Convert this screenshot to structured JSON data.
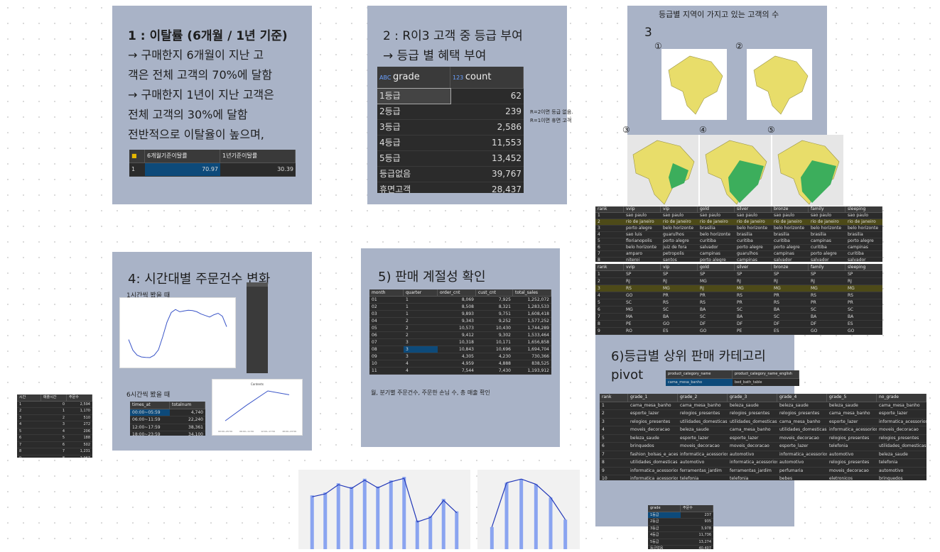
{
  "card1": {
    "title": "1 : 이탈률 (6개월 / 1년 기준)",
    "lines": [
      "→ 구매한지 6개월이 지난 고",
      "객은 전체 고객의 70%에 달함",
      "→ 구매한지 1년이 지난 고객은",
      "전체 고객의 30%에 달함",
      "전반적으로 이탈율이 높으며,"
    ],
    "grid": {
      "headers": [
        "6개월기준이탈률",
        "1년기준이탈률"
      ],
      "row_num": "1",
      "values": [
        "70.97",
        "30.39"
      ]
    }
  },
  "card2": {
    "title": "2 : R이3 고객 중 등급 부여",
    "subtitle": "→ 등급 별 혜택 부여",
    "grid": {
      "col1": "grade",
      "col2": "count",
      "rows": [
        [
          "1등급",
          "62"
        ],
        [
          "2등급",
          "239"
        ],
        [
          "3등급",
          "2,586"
        ],
        [
          "4등급",
          "11,553"
        ],
        [
          "5등급",
          "13,452"
        ],
        [
          "등급없음",
          "39,767"
        ],
        [
          "휴면고객",
          "28,437"
        ]
      ]
    },
    "note1": "R=2이면 등급 없음.",
    "note2": "R=1이면 휴면 고객"
  },
  "card3": {
    "title": "등급별 지역이 가지고 있는 고객의 수",
    "number": "3",
    "circles": [
      "①",
      "②",
      "③",
      "④",
      "⑤"
    ]
  },
  "city_grid": {
    "headers": [
      "rank",
      "vvip",
      "vip",
      "gold",
      "silver",
      "bronze",
      "family",
      "sleeping"
    ],
    "rows": [
      [
        "1",
        "sao paulo",
        "sao paulo",
        "sao paulo",
        "sao paulo",
        "sao paulo",
        "sao paulo",
        "sao paulo"
      ],
      [
        "2",
        "rio de janeiro",
        "rio de janeiro",
        "rio de janeiro",
        "rio de janeiro",
        "rio de janeiro",
        "rio de janeiro",
        "rio de janeiro"
      ],
      [
        "3",
        "porto alegre",
        "belo horizonte",
        "brasilia",
        "belo horizonte",
        "belo horizonte",
        "belo horizonte",
        "belo horizonte"
      ],
      [
        "4",
        "sao luis",
        "guarulhos",
        "belo horizonte",
        "brasilia",
        "brasilia",
        "brasilia",
        "brasilia"
      ],
      [
        "5",
        "florianopolis",
        "porto alegre",
        "curitiba",
        "curitiba",
        "curitiba",
        "campinas",
        "porto alegre"
      ],
      [
        "6",
        "belo horizonte",
        "juiz de fora",
        "salvador",
        "porto alegre",
        "porto alegre",
        "curitiba",
        "campinas"
      ],
      [
        "7",
        "amparo",
        "petropolis",
        "campinas",
        "guarulhos",
        "campinas",
        "porto alegre",
        "curitiba"
      ],
      [
        "8",
        "niteroi",
        "santos",
        "porto alegre",
        "campinas",
        "salvador",
        "salvador",
        "salvador"
      ]
    ]
  },
  "state_grid": {
    "headers": [
      "rank",
      "vvip",
      "vip",
      "gold",
      "silver",
      "bronze",
      "family",
      "sleeping"
    ],
    "rows": [
      [
        "1",
        "SP",
        "SP",
        "SP",
        "SP",
        "SP",
        "SP",
        "SP"
      ],
      [
        "2",
        "RJ",
        "RJ",
        "MG",
        "RJ",
        "RJ",
        "RJ",
        "RJ"
      ],
      [
        "3",
        "RS",
        "MG",
        "RJ",
        "MG",
        "MG",
        "MG",
        "MG"
      ],
      [
        "4",
        "GO",
        "PR",
        "PR",
        "RS",
        "PR",
        "RS",
        "RS"
      ],
      [
        "5",
        "SC",
        "RS",
        "RS",
        "PR",
        "RS",
        "PR",
        "PR"
      ],
      [
        "6",
        "MG",
        "SC",
        "BA",
        "SC",
        "BA",
        "SC",
        "SC"
      ],
      [
        "7",
        "MA",
        "BA",
        "SC",
        "BA",
        "SC",
        "BA",
        "BA"
      ],
      [
        "8",
        "PE",
        "GO",
        "DF",
        "DF",
        "DF",
        "DF",
        "ES"
      ],
      [
        "9",
        "RO",
        "ES",
        "GO",
        "PE",
        "ES",
        "GO",
        "GO"
      ],
      [
        "10",
        "PB",
        "CE",
        "PE",
        "ES",
        "GO",
        "ES",
        "DF"
      ]
    ]
  },
  "card4": {
    "title": "4: 시간대별 주문건수 변화",
    "sub1": "1시간씩 봤을 때",
    "sub2": "6시간씩 봤을 때",
    "grid6": {
      "headers": [
        "times_at",
        "totalnum"
      ],
      "rows": [
        [
          "00:00~05:59",
          "4,740"
        ],
        [
          "06:00~11:59",
          "22,240"
        ],
        [
          "12:00~17:59",
          "38,361"
        ],
        [
          "18:00~23:59",
          "34,100"
        ]
      ]
    }
  },
  "hour_grid": {
    "headers": [
      "시간",
      "매출시간",
      "주문수"
    ],
    "rows": [
      [
        "1",
        "0",
        "2,594"
      ],
      [
        "2",
        "1",
        "1,170"
      ],
      [
        "3",
        "2",
        "510"
      ],
      [
        "4",
        "3",
        "272"
      ],
      [
        "5",
        "4",
        "206"
      ],
      [
        "6",
        "5",
        "188"
      ],
      [
        "7",
        "6",
        "502"
      ],
      [
        "8",
        "7",
        "1,231"
      ],
      [
        "9",
        "8",
        "2,967"
      ]
    ]
  },
  "card5": {
    "title": "5) 판매 계절성 확인",
    "caption": "월, 분기별 주문건수, 주문한 손님 수, 총 매출 확인",
    "grid": {
      "headers": [
        "month",
        "quarter",
        "order_cnt",
        "cust_cnt",
        "total_sales"
      ],
      "rows": [
        [
          "01",
          "1",
          "8,069",
          "7,925",
          "1,252,072"
        ],
        [
          "02",
          "1",
          "8,508",
          "8,321",
          "1,283,533"
        ],
        [
          "03",
          "1",
          "9,893",
          "9,751",
          "1,608,418"
        ],
        [
          "04",
          "2",
          "9,343",
          "9,252",
          "1,577,252"
        ],
        [
          "05",
          "2",
          "10,573",
          "10,430",
          "1,744,289"
        ],
        [
          "06",
          "2",
          "9,412",
          "9,302",
          "1,533,464"
        ],
        [
          "07",
          "3",
          "10,318",
          "10,171",
          "1,656,858"
        ],
        [
          "08",
          "3",
          "10,843",
          "10,696",
          "1,694,704"
        ],
        [
          "09",
          "3",
          "4,305",
          "4,230",
          "730,366"
        ],
        [
          "10",
          "4",
          "4,959",
          "4,888",
          "838,525"
        ],
        [
          "11",
          "4",
          "7,544",
          "7,430",
          "1,193,912"
        ],
        [
          "12",
          "4",
          "5,674",
          "5,604",
          "877,610"
        ]
      ]
    }
  },
  "card6": {
    "title": "6)등급별 상위 판매 카테고리",
    "subtitle": "pivot",
    "mini": {
      "headers": [
        "product_category_name",
        "product_category_name_english"
      ],
      "row": [
        "cama_mesa_banho",
        "bed_bath_table"
      ]
    },
    "grid": {
      "headers": [
        "rank",
        "grade_1",
        "grade_2",
        "grade_3",
        "grade_4",
        "grade_5",
        "no_grade"
      ],
      "rows": [
        [
          "1",
          "cama_mesa_banho",
          "cama_mesa_banho",
          "beleza_saude",
          "beleza_saude",
          "beleza_saude",
          "cama_mesa_banho"
        ],
        [
          "2",
          "esporte_lazer",
          "relogios_presentes",
          "relogios_presentes",
          "relogios_presentes",
          "cama_mesa_banho",
          "esporte_lazer"
        ],
        [
          "3",
          "relogios_presentes",
          "utilidades_domesticas",
          "utilidades_domesticas",
          "cama_mesa_banho",
          "esporte_lazer",
          "informatica_acessorios"
        ],
        [
          "4",
          "moveis_decoracao",
          "beleza_saude",
          "cama_mesa_banho",
          "utilidades_domesticas",
          "informatica_acessorios",
          "moveis_decoracao"
        ],
        [
          "5",
          "beleza_saude",
          "esporte_lazer",
          "esporte_lazer",
          "moveis_decoracao",
          "relogios_presentes",
          "relogios_presentes"
        ],
        [
          "6",
          "brinquedos",
          "moveis_decoracao",
          "moveis_decoracao",
          "esporte_lazer",
          "telefonia",
          "utilidades_domesticas"
        ],
        [
          "7",
          "fashion_bolsas_e_acessorios",
          "informatica_acessorios",
          "automotivo",
          "informatica_acessorios",
          "automotivo",
          "beleza_saude"
        ],
        [
          "8",
          "utilidades_domesticas",
          "automotivo",
          "informatica_acessorios",
          "automotivo",
          "relogios_presentes",
          "telefonia"
        ],
        [
          "9",
          "informatica_acessorios",
          "ferramentas_jardim",
          "ferramentas_jardim",
          "perfumaria",
          "moveis_decoracao",
          "automotivo"
        ],
        [
          "10",
          "informatica_acessorios",
          "telefonia",
          "telefonia",
          "bebes",
          "eletronicos",
          "brinquedos"
        ]
      ]
    }
  },
  "grade_mini": {
    "headers": [
      "grade",
      "주문수"
    ],
    "rows": [
      [
        "1등급",
        "237"
      ],
      [
        "2등급",
        "935"
      ],
      [
        "3등급",
        "3,978"
      ],
      [
        "4등급",
        "11,736"
      ],
      [
        "5등급",
        "13,274"
      ],
      [
        "등급없음",
        "40,407"
      ]
    ]
  },
  "chart_data": [
    {
      "type": "line",
      "title": "",
      "series": [
        {
          "values": [
            2594,
            1170,
            510,
            272,
            206,
            188,
            502,
            1231,
            2967,
            4900,
            6200,
            6600,
            6300,
            6400,
            6500,
            6450,
            6300,
            6000,
            5800,
            5600,
            5900,
            6100,
            5700,
            4300
          ]
        }
      ]
    },
    {
      "type": "line",
      "title": "Contents",
      "categories": [
        "00:00~05:59",
        "06:00~11:59",
        "12:00~17:59",
        "18:00~23:59"
      ],
      "series": [
        {
          "values": [
            4740,
            22240,
            38361,
            34100
          ]
        }
      ]
    },
    {
      "type": "bar",
      "series": [
        {
          "values": [
            8069,
            8508,
            9893,
            9343,
            10573,
            9412,
            10318,
            10843,
            4305,
            4959,
            7544,
            5674
          ]
        }
      ]
    },
    {
      "type": "bar",
      "series": [
        {
          "values": [
            30,
            90,
            95,
            88,
            70,
            40
          ]
        }
      ]
    }
  ],
  "colors": {
    "card": "#a9b3c7",
    "grid_bg": "#2b2b2b",
    "selected": "#0d4a7a",
    "bar": "#8aa4f0",
    "line": "#2238b8",
    "map_yellow": "#e8dd6a",
    "map_green": "#3cae5c"
  }
}
